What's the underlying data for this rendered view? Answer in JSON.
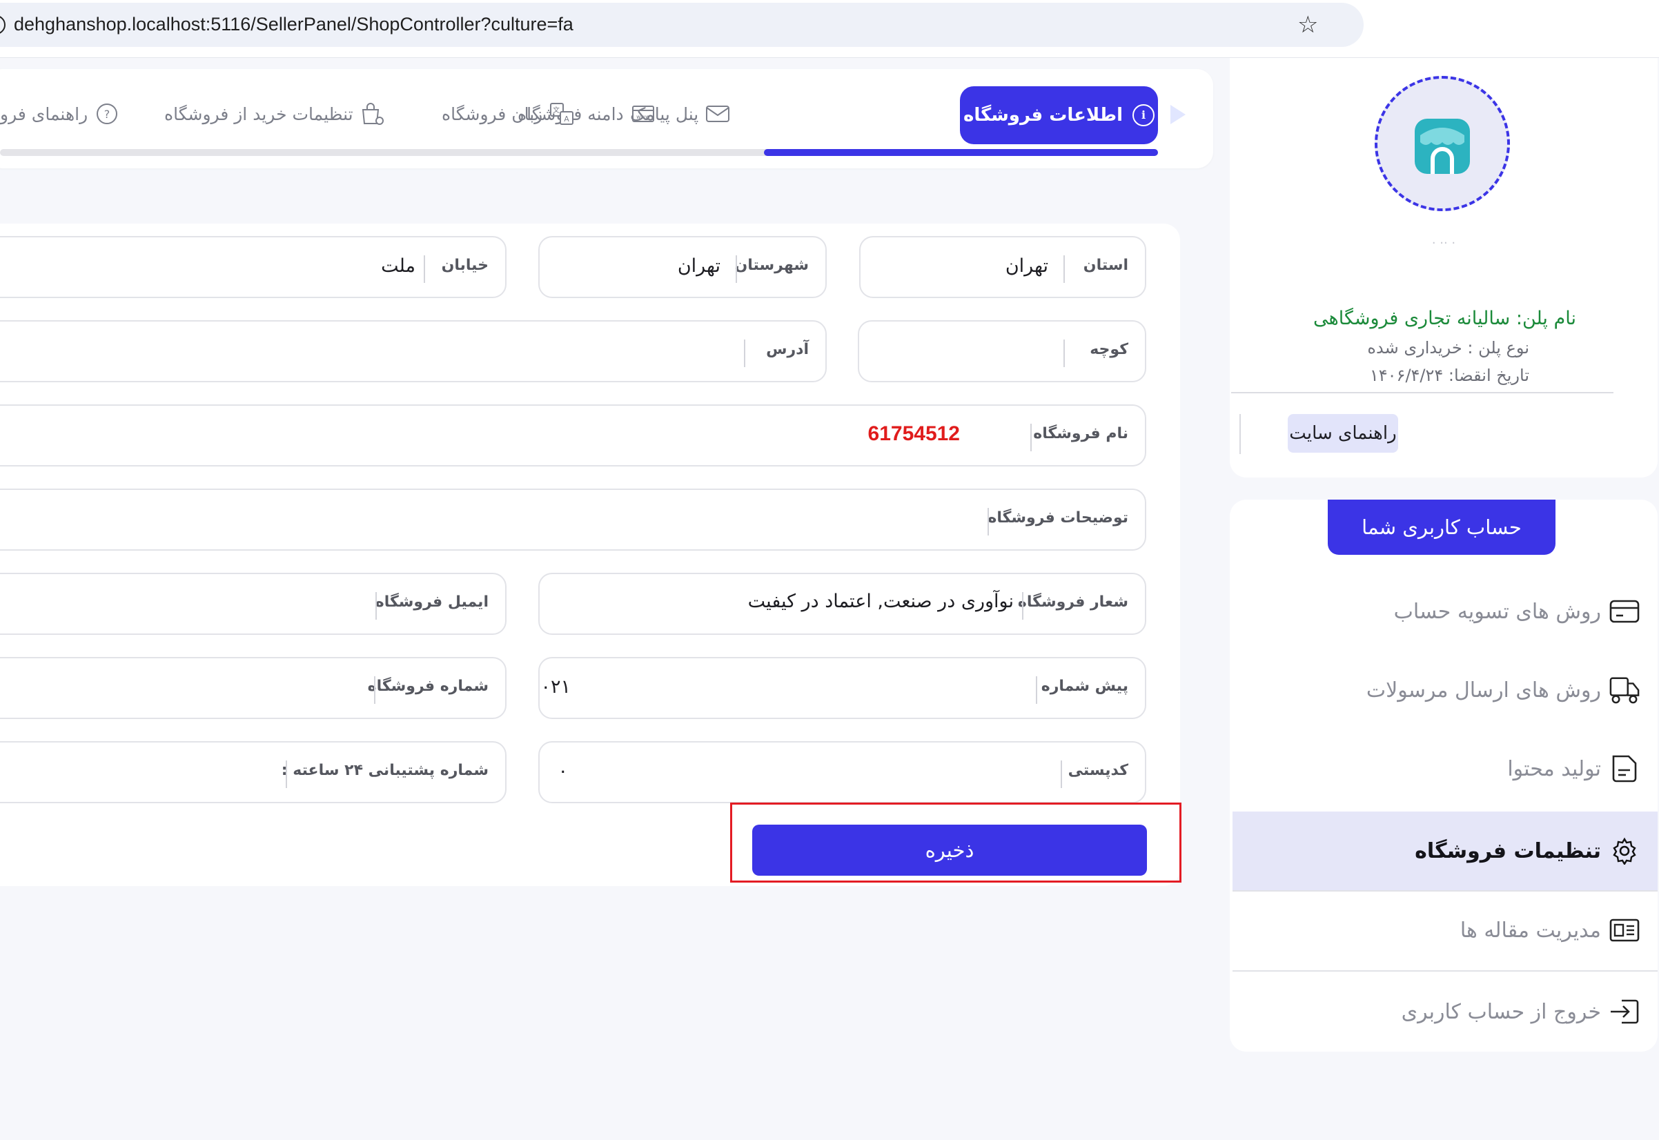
{
  "browser": {
    "url": "dehghanshop.localhost:5116/SellerPanel/ShopController?culture=fa",
    "info_icon": "info-icon",
    "star_icon": "star-icon"
  },
  "tabs": {
    "active": {
      "label": "اطلاعات فروشگاه",
      "icon": "info-circle-icon"
    },
    "items": [
      {
        "label": "دامنه فروشگاه",
        "icon": "domain-icon"
      },
      {
        "label": "پنل پیامک",
        "icon": "mail-icon"
      },
      {
        "label": "زبان فروشگاه",
        "icon": "translate-icon"
      },
      {
        "label": "تنظیمات خرید از فروشگاه",
        "icon": "shopping-bag-settings-icon"
      },
      {
        "label": "راهنمای فرو",
        "icon": "help-circle-icon"
      }
    ],
    "progress_fraction": 0.34
  },
  "form": {
    "province": {
      "label": "استان",
      "value": "تهران"
    },
    "city": {
      "label": "شهرستان",
      "value": "تهران"
    },
    "street": {
      "label": "خیابان",
      "value": "ملت"
    },
    "alley": {
      "label": "کوچه",
      "value": ""
    },
    "address": {
      "label": "آدرس",
      "value": ""
    },
    "shop_name": {
      "label": "نام فروشگاه",
      "value": "61754512"
    },
    "shop_description": {
      "label": "توضیحات فروشگاه",
      "value": ""
    },
    "shop_slogan": {
      "label": "شعار فروشگاه",
      "value": "نوآوری در صنعت, اعتماد در کیفیت"
    },
    "shop_email": {
      "label": "ایمیل فروشگاه",
      "value": "."
    },
    "area_code": {
      "label": "پیش شماره",
      "value": "۰۲۱"
    },
    "shop_phone": {
      "label": "شماره فروشگاه",
      "value": "۔"
    },
    "postal_code": {
      "label": "کدپستی",
      "value": "۰"
    },
    "support_phone": {
      "label": "شماره پشتیبانی ۲۴ ساعته :",
      "value": ""
    },
    "save_label": "ذخیره"
  },
  "profile": {
    "faded_text": "· ·· ·",
    "plan_name": "نام پلن: سالیانه تجاری فروشگاهی",
    "plan_type": "نوع پلن : خریداری شده",
    "plan_expiry": "تاریخ انقضا: ۱۴۰۶/۴/۲۴",
    "site_guide": "راهنمای سایت"
  },
  "menu": {
    "account_label": "حساب کاربری شما",
    "items": [
      {
        "label": "روش های تسویه حساب",
        "icon": "credit-card-icon",
        "active": false
      },
      {
        "label": "روش های ارسال مرسولات",
        "icon": "delivery-truck-icon",
        "active": false
      },
      {
        "label": "تولید محتوا",
        "icon": "document-icon",
        "active": false
      },
      {
        "label": "تنظیمات فروشگاه",
        "icon": "gear-icon",
        "active": true
      },
      {
        "label": "مدیریت مقاله ها",
        "icon": "newspaper-icon",
        "active": false
      },
      {
        "label": "خروج از حساب کاربری",
        "icon": "logout-icon",
        "active": false
      }
    ]
  },
  "colors": {
    "primary": "#3b34e6",
    "plan_green": "#1b8a3a",
    "shop_name_red": "#e01c1c",
    "highlight_red": "#e31c24",
    "logo_teal": "#2cb3c0"
  }
}
